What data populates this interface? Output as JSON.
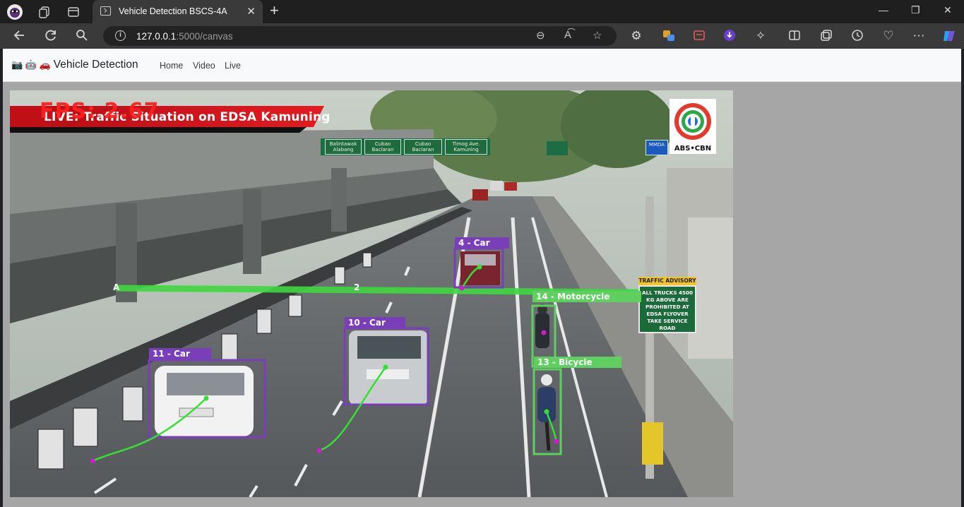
{
  "browser": {
    "tab_title": "Vehicle Detection BSCS-4A",
    "url_host": "127.0.0.1",
    "url_rest": ":5000/canvas"
  },
  "navbar": {
    "brand_emojis": "📷 🤖 🚗",
    "brand": "Vehicle Detection",
    "links": [
      "Home",
      "Video",
      "Live"
    ]
  },
  "video": {
    "banner_title": "LIVE: Traffic Situation on EDSA Kamuning",
    "fps_text": "FPS: 2.67",
    "logo_text": "ABS•CBN",
    "line_labels": [
      "A",
      "2"
    ],
    "detections": [
      {
        "label": "4 - Car",
        "class": "Car"
      },
      {
        "label": "10 - Car",
        "class": "Car"
      },
      {
        "label": "11 - Car",
        "class": "Car"
      },
      {
        "label": "14 - Motorcycle",
        "class": "Motorcycle"
      },
      {
        "label": "13 - Bicycle",
        "class": "Bicycle"
      }
    ],
    "signs": {
      "sign1": "Balintawak\nAlabang",
      "sign2": "Cubao\nBaclaran",
      "sign3": "Cubao\nBaclaran",
      "sign4": "Timog Ave.\nKamuning",
      "mmda": "MMDA",
      "advisory_head": "TRAFFIC ADVISORY",
      "advisory_body": "ALL TRUCKS 4500 KG ABOVE ARE PROHIBITED AT EDSA FLYOVER TAKE SERVICE ROAD"
    },
    "colors": {
      "car_box": "#7a3fb8",
      "moto_box": "#5fcf5f",
      "line": "#3fd83f",
      "trail": "#33e033",
      "point": "#d01ad0"
    }
  }
}
